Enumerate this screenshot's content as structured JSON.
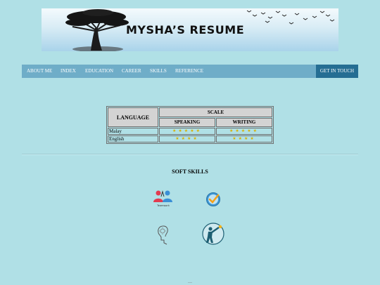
{
  "header": {
    "banner_title": "MYSHA’S RESUME"
  },
  "nav": {
    "items": [
      "ABOUT ME",
      "INDEX",
      "EDUCATION",
      "CAREER",
      "SKILLS",
      "REFERENCE"
    ],
    "cta": "GET IN TOUCH"
  },
  "language_table": {
    "headers": {
      "language": "LANGUAGE",
      "scale": "SCALE",
      "speaking": "SPEAKING",
      "writing": "WRITING"
    },
    "rows": [
      {
        "language": "Malay",
        "speaking_stars": 5,
        "writing_stars": 5
      },
      {
        "language": "English",
        "speaking_stars": 4,
        "writing_stars": 4
      }
    ],
    "star_glyph": "★",
    "star_color": "#d8b000"
  },
  "soft_skills": {
    "title": "SOFT SKILLS",
    "icons": [
      "teamwork-icon",
      "checkmark-badge-icon",
      "idea-head-icon",
      "vision-telescope-icon"
    ],
    "teamwork_label": "Teamwork"
  },
  "colors": {
    "background": "#b0e0e6",
    "nav": "#6fadc8",
    "cta": "#256e93"
  }
}
